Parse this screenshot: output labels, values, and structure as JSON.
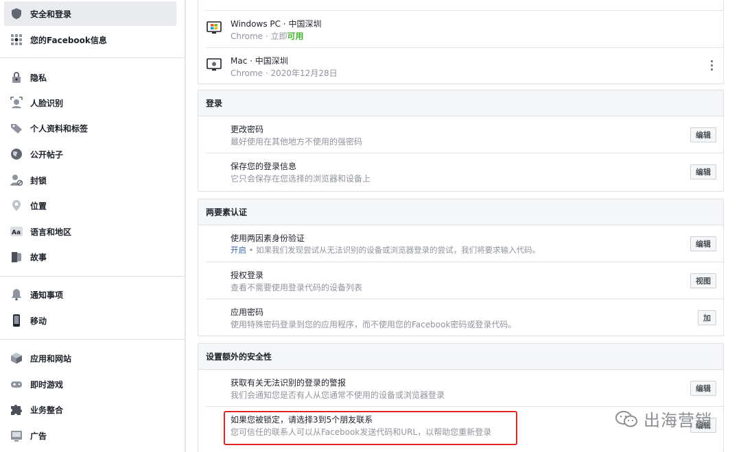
{
  "sidebar": {
    "items": [
      {
        "label": "安全和登录",
        "icon": "shield-icon"
      },
      {
        "label": "您的Facebook信息",
        "icon": "grid-icon"
      },
      {
        "label": "隐私",
        "icon": "lock-icon"
      },
      {
        "label": "人脸识别",
        "icon": "face-icon"
      },
      {
        "label": "个人资料和标签",
        "icon": "tag-icon"
      },
      {
        "label": "公开帖子",
        "icon": "globe-icon"
      },
      {
        "label": "封锁",
        "icon": "block-user-icon"
      },
      {
        "label": "位置",
        "icon": "location-pin-icon"
      },
      {
        "label": "语言和地区",
        "icon": "language-icon"
      },
      {
        "label": "故事",
        "icon": "story-icon"
      },
      {
        "label": "通知事项",
        "icon": "bell-icon"
      },
      {
        "label": "移动",
        "icon": "mobile-icon"
      },
      {
        "label": "应用和网站",
        "icon": "apps-icon"
      },
      {
        "label": "即时游戏",
        "icon": "game-icon"
      },
      {
        "label": "业务整合",
        "icon": "puzzle-icon"
      },
      {
        "label": "广告",
        "icon": "ads-icon"
      }
    ]
  },
  "devices": [
    {
      "title": "Windows PC · 中国深圳",
      "sub": "Chrome · 立即",
      "status": "可用",
      "icon": "windows-pc-icon"
    },
    {
      "title": "Mac · 中国深圳",
      "sub": "Chrome · 2020年12月28日",
      "icon": "mac-icon"
    }
  ],
  "login": {
    "header": "登录",
    "rows": [
      {
        "title": "更改密码",
        "sub": "最好使用在其他地方不使用的强密码",
        "button": "编辑"
      },
      {
        "title": "保存您的登录信息",
        "sub": "它只会保存在您选择的浏览器和设备上",
        "button": "编辑"
      }
    ]
  },
  "twofa": {
    "header": "两要素认证",
    "rows": [
      {
        "title": "使用两因素身份验证",
        "sub_status": "开启",
        "sub": " • 如果我们发现尝试从无法识别的设备或浏览器登录的尝试，我们将要求输入代码。",
        "button": "编辑"
      },
      {
        "title": "授权登录",
        "sub": "查看不需要使用登录代码的设备列表",
        "button": "视图"
      },
      {
        "title": "应用密码",
        "sub": "使用特殊密码登录到您的应用程序，而不使用您的Facebook密码或登录代码。",
        "button": "加"
      }
    ]
  },
  "extra": {
    "header": "设置额外的安全性",
    "rows": [
      {
        "title": "获取有关无法识别的登录的警报",
        "sub": "我们会通知您是否有人从您通常不使用的设备或浏览器登录",
        "button": "编辑"
      },
      {
        "title": "如果您被锁定，请选择3到5个朋友联系",
        "sub": "您可信任的联系人可以从Facebook发送代码和URL，以帮助您重新登录",
        "button": "编辑"
      }
    ]
  },
  "watermark": "出海营销",
  "colors": {
    "accent": "#4267b2",
    "active_green": "#42b72a",
    "highlight": "#e0261e"
  }
}
